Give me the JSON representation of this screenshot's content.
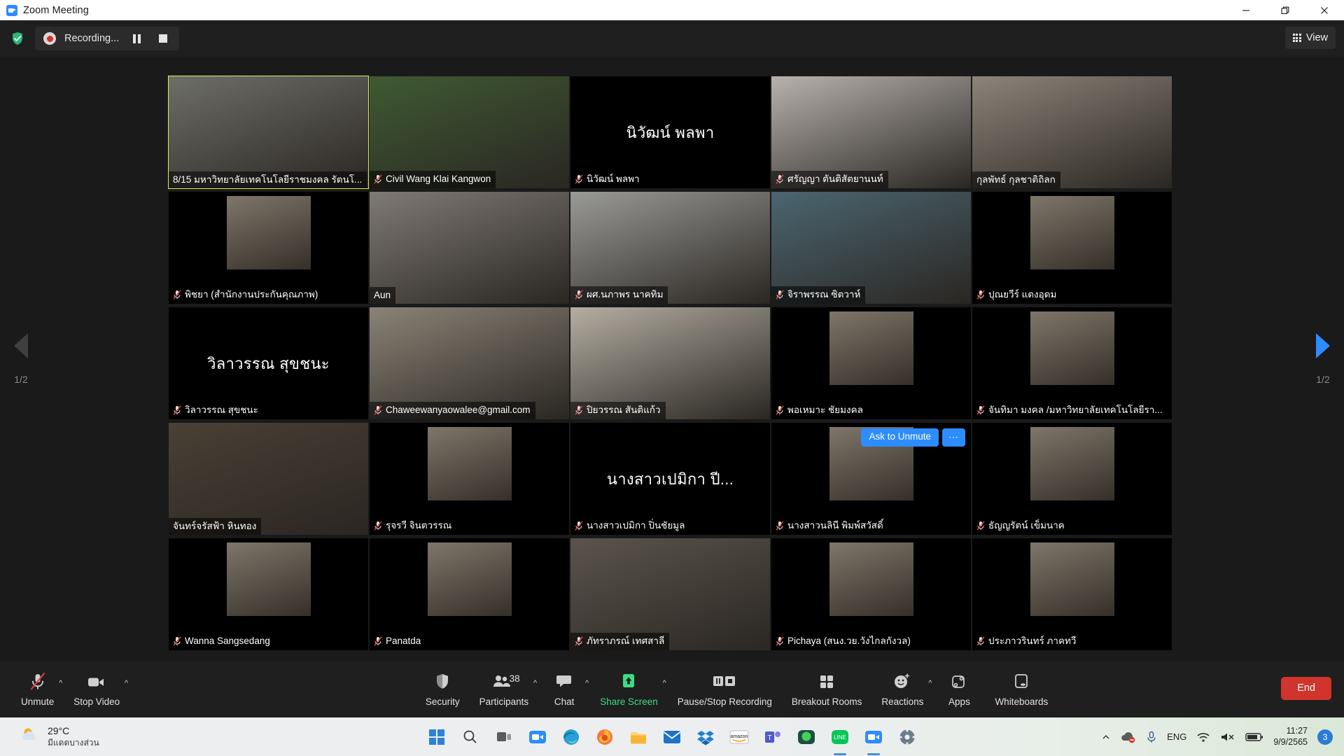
{
  "window": {
    "title": "Zoom Meeting",
    "minimize_label": "Minimize",
    "restore_label": "Restore",
    "close_label": "Close"
  },
  "topbar": {
    "encryption_icon": "shield-check-icon",
    "recording_label": "Recording...",
    "pause_label": "Pause Recording",
    "stop_label": "Stop Recording",
    "view_label": "View"
  },
  "gallery": {
    "page_left": "1/2",
    "page_right": "1/2",
    "ask_to_unmute_label": "Ask to Unmute",
    "more_label": "⋯",
    "tiles": [
      {
        "name": "8/15 มหาวิทยาลัยเทคโนโลยีราชมงคล รัตนโ...",
        "muted": false,
        "active": true,
        "style": "video",
        "bg": "#6e6e68",
        "center": ""
      },
      {
        "name": "Civil Wang Klai Kangwon",
        "muted": true,
        "active": false,
        "style": "video",
        "bg": "#3f5a33",
        "center": ""
      },
      {
        "name": "นิวัฒน์ พลพา",
        "muted": true,
        "active": false,
        "style": "name",
        "bg": "#000000",
        "center": "นิวัฒน์ พลพา"
      },
      {
        "name": "ศรัญญา ตันติสัตยานนท์",
        "muted": true,
        "active": false,
        "style": "video",
        "bg": "#b7b2ae",
        "center": ""
      },
      {
        "name": "กุลพัทธ์ กุลชาติถิลก",
        "muted": false,
        "active": false,
        "style": "video",
        "bg": "#8c8479",
        "center": ""
      },
      {
        "name": "พิชยา (สำนักงานประกันคุณภาพ)",
        "muted": true,
        "active": false,
        "style": "portrait",
        "bg": "#000000",
        "center": ""
      },
      {
        "name": "Aun",
        "muted": false,
        "active": false,
        "style": "video",
        "bg": "#7f7a75",
        "center": ""
      },
      {
        "name": "ผศ.นภาพร นาคทิม",
        "muted": true,
        "active": false,
        "style": "video",
        "bg": "#9a9a96",
        "center": ""
      },
      {
        "name": "จิราพรรณ ซิตวาห์",
        "muted": true,
        "active": false,
        "style": "video",
        "bg": "#4b6570",
        "center": ""
      },
      {
        "name": "ปุณยวีร์ แตงอุดม",
        "muted": true,
        "active": false,
        "style": "portrait",
        "bg": "#000000",
        "center": ""
      },
      {
        "name": "วิลาวรรณ สุขชนะ",
        "muted": true,
        "active": false,
        "style": "name",
        "bg": "#000000",
        "center": "วิลาวรรณ สุขชนะ"
      },
      {
        "name": "Chaweewanyaowalee@gmail.com",
        "muted": true,
        "active": false,
        "style": "video",
        "bg": "#8a8376",
        "center": ""
      },
      {
        "name": "ปิยวรรณ สันติแก้ว",
        "muted": true,
        "active": false,
        "style": "video",
        "bg": "#b4aea2",
        "center": ""
      },
      {
        "name": "พอเหมาะ ชัยมงคล",
        "muted": true,
        "active": false,
        "style": "portrait",
        "bg": "#000000",
        "center": ""
      },
      {
        "name": "จันทิมา มงคล /มหาวิทยาลัยเทคโนโลยีรา...",
        "muted": true,
        "active": false,
        "style": "portrait",
        "bg": "#000000",
        "center": ""
      },
      {
        "name": "จันทร์จรัสฟ้า หินทอง",
        "muted": false,
        "active": false,
        "style": "video",
        "bg": "#4a4035",
        "center": ""
      },
      {
        "name": "รุจรวี จินตวรรณ",
        "muted": true,
        "active": false,
        "style": "portrait",
        "bg": "#000000",
        "center": ""
      },
      {
        "name": "นางสาวเปมิกา ปิ่นชัยมูล",
        "muted": true,
        "active": false,
        "style": "name",
        "bg": "#000000",
        "center": "นางสาวเปมิกา ปี..."
      },
      {
        "name": "นางสาวนลินี พิมพ์สวัสดิ์",
        "muted": true,
        "active": false,
        "style": "portrait",
        "bg": "#000000",
        "center": ""
      },
      {
        "name": "ธัญญรัตน์ เข็มนาค",
        "muted": true,
        "active": false,
        "style": "portrait",
        "bg": "#000000",
        "center": ""
      },
      {
        "name": "Wanna Sangsedang",
        "muted": true,
        "active": false,
        "style": "portrait",
        "bg": "#000000",
        "center": ""
      },
      {
        "name": "Panatda",
        "muted": true,
        "active": false,
        "style": "portrait",
        "bg": "#000000",
        "center": ""
      },
      {
        "name": "ภัทราภรณ์ เทศสาลี",
        "muted": true,
        "active": false,
        "style": "video",
        "bg": "#5a544c",
        "center": ""
      },
      {
        "name": "Pichaya (สนง.วย.วังไกลกังวล)",
        "muted": true,
        "active": false,
        "style": "portrait",
        "bg": "#000000",
        "center": ""
      },
      {
        "name": "ประภาวรินทร์ ภาคทวี",
        "muted": true,
        "active": false,
        "style": "portrait",
        "bg": "#000000",
        "center": ""
      }
    ]
  },
  "toolbar": {
    "left": [
      {
        "label": "Unmute",
        "icon": "mic-muted-icon",
        "caret": true
      },
      {
        "label": "Stop Video",
        "icon": "video-camera-icon",
        "caret": true
      }
    ],
    "center": [
      {
        "label": "Security",
        "icon": "shield-icon",
        "caret": false
      },
      {
        "label": "Participants",
        "icon": "participants-icon",
        "caret": true,
        "count": "38"
      },
      {
        "label": "Chat",
        "icon": "chat-bubble-icon",
        "caret": true
      },
      {
        "label": "Share Screen",
        "icon": "share-screen-icon",
        "caret": true
      },
      {
        "label": "Pause/Stop Recording",
        "icon": "pause-stop-recording-icon",
        "caret": false
      },
      {
        "label": "Breakout Rooms",
        "icon": "breakout-rooms-icon",
        "caret": false
      },
      {
        "label": "Reactions",
        "icon": "reactions-icon",
        "caret": true
      },
      {
        "label": "Apps",
        "icon": "apps-icon",
        "caret": false
      },
      {
        "label": "Whiteboards",
        "icon": "whiteboard-icon",
        "caret": false
      }
    ],
    "end_label": "End"
  },
  "taskbar": {
    "weather_temp": "29°C",
    "weather_desc": "มีแดดบางส่วน",
    "apps": [
      "windows-start-icon",
      "search-icon",
      "task-view-icon",
      "zoom-app-icon",
      "edge-browser-icon",
      "firefox-browser-icon",
      "file-explorer-icon",
      "mail-icon",
      "dropbox-icon",
      "amazon-icon",
      "teams-icon",
      "line-desktop-icon",
      "line-icon",
      "zoom-meeting-icon",
      "settings-icon"
    ],
    "language": "ENG",
    "time": "11:27",
    "date": "9/9/2565",
    "notification_count": "3"
  },
  "colors": {
    "accent_blue": "#2d8cff",
    "active_speaker": "#d8ef5a",
    "share_green": "#3ddc84",
    "end_red": "#d0342c"
  }
}
